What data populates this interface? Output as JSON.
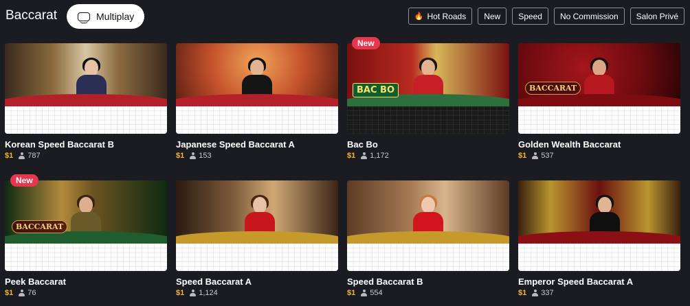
{
  "header": {
    "title": "Baccarat",
    "multiplay_label": "Multiplay",
    "filters": [
      "Hot Roads",
      "New",
      "Speed",
      "No Commission",
      "Salon Privé"
    ]
  },
  "colors": {
    "background": "#1b1c22",
    "new_badge": "#e5384f",
    "min_bet": "#f2b736",
    "banker_dot": "#e5384f",
    "player_dot": "#3a6fd0"
  },
  "tables": [
    {
      "name": "Korean Speed Baccarat B",
      "min_bet": "$1",
      "players": "787",
      "badge": "",
      "logo": "",
      "theme": "korean"
    },
    {
      "name": "Japanese Speed Baccarat A",
      "min_bet": "$1",
      "players": "153",
      "badge": "",
      "logo": "",
      "theme": "japanese"
    },
    {
      "name": "Bac Bo",
      "min_bet": "$1",
      "players": "1,172",
      "badge": "New",
      "logo": "BAC BO",
      "theme": "bacbo"
    },
    {
      "name": "Golden Wealth Baccarat",
      "min_bet": "$1",
      "players": "537",
      "badge": "",
      "logo": "BACCARAT",
      "theme": "golden"
    },
    {
      "name": "Peek Baccarat",
      "min_bet": "$1",
      "players": "76",
      "badge": "New",
      "logo": "BACCARAT",
      "theme": "peek"
    },
    {
      "name": "Speed Baccarat A",
      "min_bet": "$1",
      "players": "1,124",
      "badge": "",
      "logo": "",
      "theme": "speedA"
    },
    {
      "name": "Speed Baccarat B",
      "min_bet": "$1",
      "players": "554",
      "badge": "",
      "logo": "",
      "theme": "speedB"
    },
    {
      "name": "Emperor Speed Baccarat A",
      "min_bet": "$1",
      "players": "337",
      "badge": "",
      "logo": "",
      "theme": "emperor"
    }
  ]
}
